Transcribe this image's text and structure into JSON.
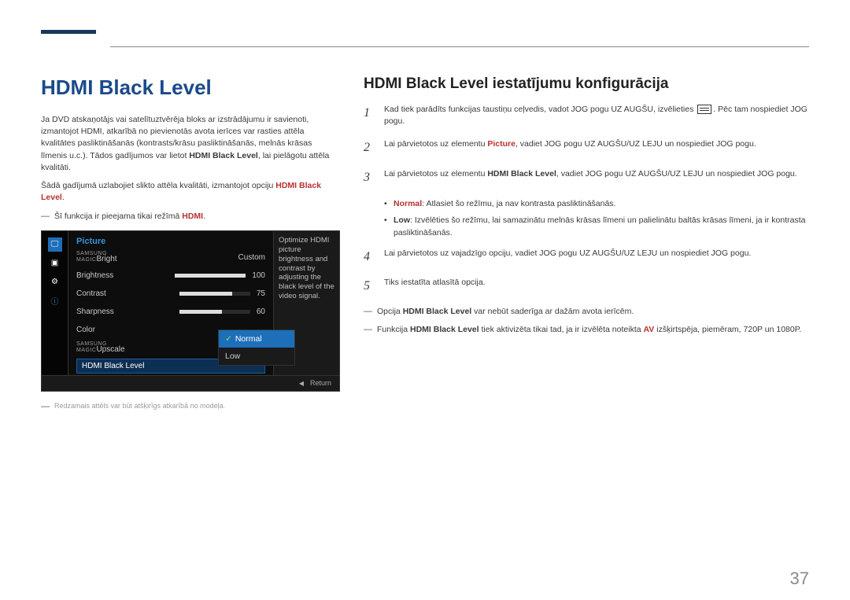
{
  "page_number": "37",
  "left": {
    "title": "HDMI Black Level",
    "para1_a": "Ja DVD atskaņotājs vai satelītuztvērēja bloks ar izstrādājumu ir savienoti, izmantojot HDMI, atkarībā no pievienotās avota ierīces var rasties attēla kvalitātes pasliktināšanās (kontrasts/krāsu pasliktināšanās, melnās krāsas līmenis u.c.). Tādos gadījumos var lietot ",
    "para1_hl": "HDMI Black Level",
    "para1_b": ", lai pielāgotu attēla kvalitāti.",
    "para2_a": "Šādā gadījumā uzlabojiet slikto attēla kvalitāti, izmantojot opciju ",
    "para2_hl": "HDMI Black Level",
    "para2_b": ".",
    "note1_a": "Šī funkcija ir pieejama tikai režīmā ",
    "note1_hl": "HDMI",
    "note1_b": ".",
    "caption": "Redzamais attēls var būt atšķirīgs atkarībā no modeļa."
  },
  "osd": {
    "header": "Picture",
    "bright_prefix": "SAMSUNG",
    "bright": "Bright",
    "bright_line2": "MAGIC",
    "bright_val": "Custom",
    "brightness": "Brightness",
    "brightness_val": "100",
    "contrast": "Contrast",
    "contrast_val": "75",
    "sharpness": "Sharpness",
    "sharpness_val": "60",
    "color": "Color",
    "upscale_prefix": "SAMSUNG",
    "upscale": "Upscale",
    "upscale_line2": "MAGIC",
    "hdmi_black": "HDMI Black Level",
    "tip": "Optimize HDMI picture brightness and contrast by adjusting the black level of the video signal.",
    "opt_normal": "Normal",
    "opt_low": "Low",
    "return": "Return"
  },
  "right": {
    "title": "HDMI Black Level iestatījumu konfigurācija",
    "s1_a": "Kad tiek parādīts funkcijas taustiņu ceļvedis, vadot JOG pogu UZ AUGŠU, izvēlieties ",
    "s1_b": ". Pēc tam nospiediet JOG pogu.",
    "s2_a": "Lai pārvietotos uz elementu ",
    "s2_hl": "Picture",
    "s2_b": ", vadiet JOG pogu UZ AUGŠU/UZ LEJU un nospiediet JOG pogu.",
    "s3_a": "Lai pārvietotos uz elementu ",
    "s3_hl": "HDMI Black Level",
    "s3_b": ", vadiet JOG pogu UZ AUGŠU/UZ LEJU un nospiediet JOG pogu.",
    "b1_hl": "Normal",
    "b1": ": Atlasiet šo režīmu, ja nav kontrasta pasliktināšanās.",
    "b2_hl": "Low",
    "b2": ": Izvēlēties šo režīmu, lai samazinātu melnās krāsas līmeni un palielinātu baltās krāsas līmeni, ja ir kontrasta pasliktināšanās.",
    "s4": "Lai pārvietotos uz vajadzīgo opciju, vadiet JOG pogu UZ AUGŠU/UZ LEJU un nospiediet JOG pogu.",
    "s5": "Tiks iestatīta atlasītā opcija.",
    "n1_a": "Opcija ",
    "n1_hl": "HDMI Black Level",
    "n1_b": " var nebūt saderīga ar dažām avota ierīcēm.",
    "n2_a": "Funkcija ",
    "n2_hl1": "HDMI Black Level",
    "n2_m": " tiek aktivizēta tikai tad, ja ir izvēlēta noteikta ",
    "n2_hl2": "AV",
    "n2_b": " izšķirtspēja, piemēram, 720P un 1080P."
  }
}
